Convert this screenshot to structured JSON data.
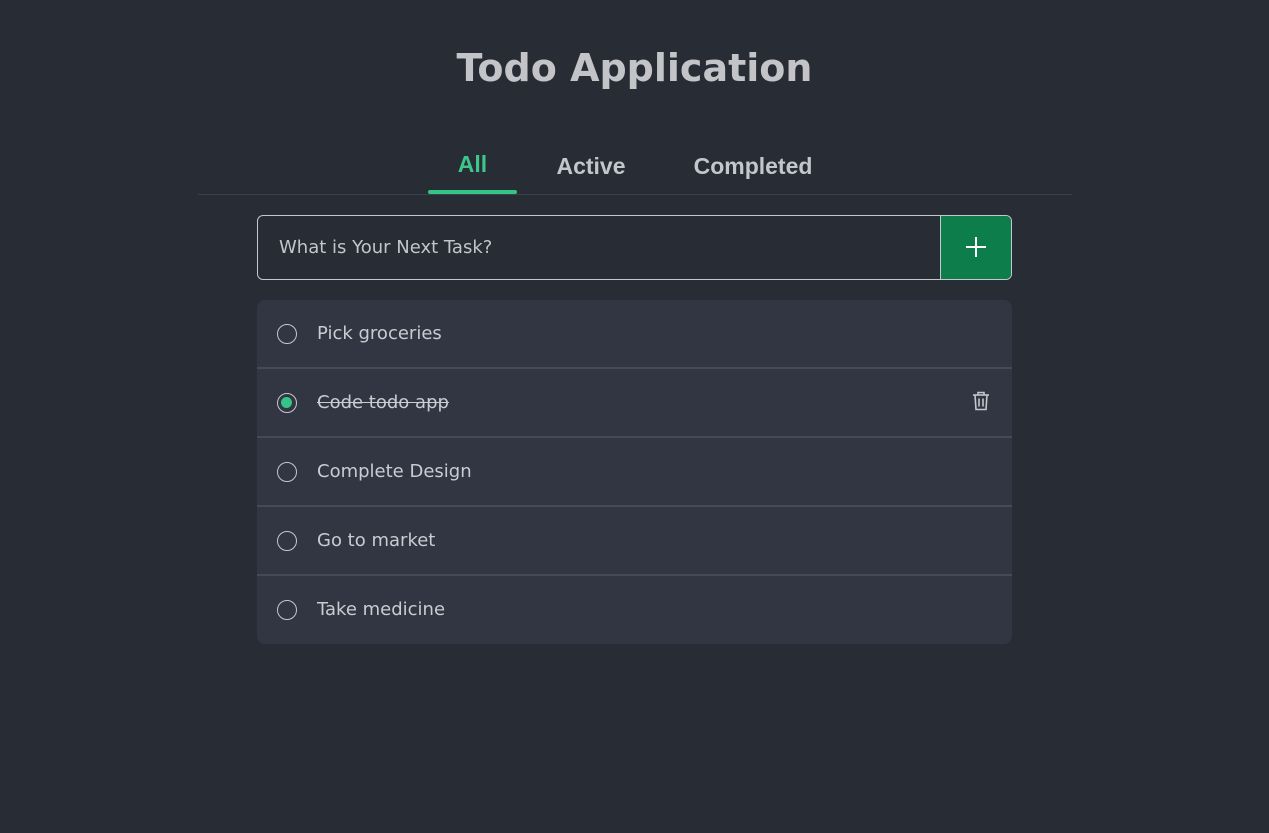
{
  "app": {
    "title": "Todo Application"
  },
  "tabs": [
    {
      "label": "All",
      "selected": true
    },
    {
      "label": "Active",
      "selected": false
    },
    {
      "label": "Completed",
      "selected": false
    }
  ],
  "new_task": {
    "placeholder": "What is Your Next Task?",
    "value": "",
    "add_icon": "plus-icon"
  },
  "tasks": [
    {
      "label": "Pick groceries",
      "completed": false
    },
    {
      "label": "Code todo app",
      "completed": true,
      "action_icon": "trash-icon"
    },
    {
      "label": "Complete Design",
      "completed": false
    },
    {
      "label": "Go to market",
      "completed": false
    },
    {
      "label": "Take medicine",
      "completed": false
    }
  ],
  "colors": {
    "background": "#282c34",
    "panel": "#313642",
    "accent": "#34c486",
    "add_button": "#0d7d4b"
  }
}
